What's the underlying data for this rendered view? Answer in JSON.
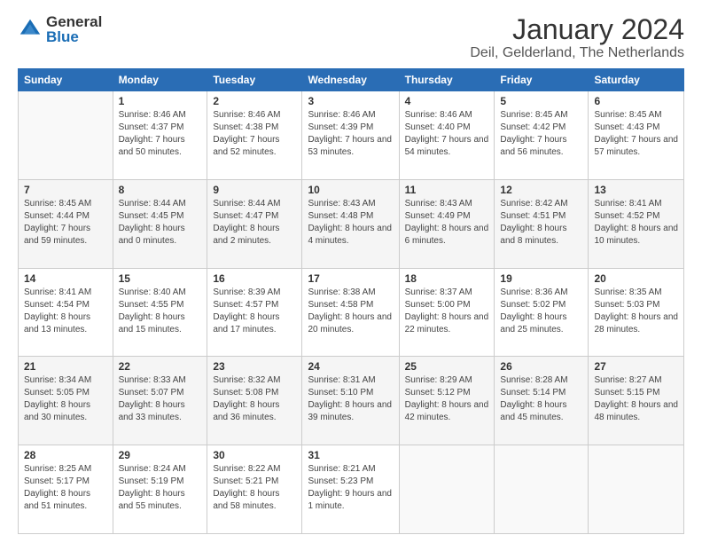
{
  "logo": {
    "general": "General",
    "blue": "Blue"
  },
  "header": {
    "month": "January 2024",
    "location": "Deil, Gelderland, The Netherlands"
  },
  "weekdays": [
    "Sunday",
    "Monday",
    "Tuesday",
    "Wednesday",
    "Thursday",
    "Friday",
    "Saturday"
  ],
  "weeks": [
    [
      {
        "day": "",
        "sunrise": "",
        "sunset": "",
        "daylight": ""
      },
      {
        "day": "1",
        "sunrise": "Sunrise: 8:46 AM",
        "sunset": "Sunset: 4:37 PM",
        "daylight": "Daylight: 7 hours and 50 minutes."
      },
      {
        "day": "2",
        "sunrise": "Sunrise: 8:46 AM",
        "sunset": "Sunset: 4:38 PM",
        "daylight": "Daylight: 7 hours and 52 minutes."
      },
      {
        "day": "3",
        "sunrise": "Sunrise: 8:46 AM",
        "sunset": "Sunset: 4:39 PM",
        "daylight": "Daylight: 7 hours and 53 minutes."
      },
      {
        "day": "4",
        "sunrise": "Sunrise: 8:46 AM",
        "sunset": "Sunset: 4:40 PM",
        "daylight": "Daylight: 7 hours and 54 minutes."
      },
      {
        "day": "5",
        "sunrise": "Sunrise: 8:45 AM",
        "sunset": "Sunset: 4:42 PM",
        "daylight": "Daylight: 7 hours and 56 minutes."
      },
      {
        "day": "6",
        "sunrise": "Sunrise: 8:45 AM",
        "sunset": "Sunset: 4:43 PM",
        "daylight": "Daylight: 7 hours and 57 minutes."
      }
    ],
    [
      {
        "day": "7",
        "sunrise": "Sunrise: 8:45 AM",
        "sunset": "Sunset: 4:44 PM",
        "daylight": "Daylight: 7 hours and 59 minutes."
      },
      {
        "day": "8",
        "sunrise": "Sunrise: 8:44 AM",
        "sunset": "Sunset: 4:45 PM",
        "daylight": "Daylight: 8 hours and 0 minutes."
      },
      {
        "day": "9",
        "sunrise": "Sunrise: 8:44 AM",
        "sunset": "Sunset: 4:47 PM",
        "daylight": "Daylight: 8 hours and 2 minutes."
      },
      {
        "day": "10",
        "sunrise": "Sunrise: 8:43 AM",
        "sunset": "Sunset: 4:48 PM",
        "daylight": "Daylight: 8 hours and 4 minutes."
      },
      {
        "day": "11",
        "sunrise": "Sunrise: 8:43 AM",
        "sunset": "Sunset: 4:49 PM",
        "daylight": "Daylight: 8 hours and 6 minutes."
      },
      {
        "day": "12",
        "sunrise": "Sunrise: 8:42 AM",
        "sunset": "Sunset: 4:51 PM",
        "daylight": "Daylight: 8 hours and 8 minutes."
      },
      {
        "day": "13",
        "sunrise": "Sunrise: 8:41 AM",
        "sunset": "Sunset: 4:52 PM",
        "daylight": "Daylight: 8 hours and 10 minutes."
      }
    ],
    [
      {
        "day": "14",
        "sunrise": "Sunrise: 8:41 AM",
        "sunset": "Sunset: 4:54 PM",
        "daylight": "Daylight: 8 hours and 13 minutes."
      },
      {
        "day": "15",
        "sunrise": "Sunrise: 8:40 AM",
        "sunset": "Sunset: 4:55 PM",
        "daylight": "Daylight: 8 hours and 15 minutes."
      },
      {
        "day": "16",
        "sunrise": "Sunrise: 8:39 AM",
        "sunset": "Sunset: 4:57 PM",
        "daylight": "Daylight: 8 hours and 17 minutes."
      },
      {
        "day": "17",
        "sunrise": "Sunrise: 8:38 AM",
        "sunset": "Sunset: 4:58 PM",
        "daylight": "Daylight: 8 hours and 20 minutes."
      },
      {
        "day": "18",
        "sunrise": "Sunrise: 8:37 AM",
        "sunset": "Sunset: 5:00 PM",
        "daylight": "Daylight: 8 hours and 22 minutes."
      },
      {
        "day": "19",
        "sunrise": "Sunrise: 8:36 AM",
        "sunset": "Sunset: 5:02 PM",
        "daylight": "Daylight: 8 hours and 25 minutes."
      },
      {
        "day": "20",
        "sunrise": "Sunrise: 8:35 AM",
        "sunset": "Sunset: 5:03 PM",
        "daylight": "Daylight: 8 hours and 28 minutes."
      }
    ],
    [
      {
        "day": "21",
        "sunrise": "Sunrise: 8:34 AM",
        "sunset": "Sunset: 5:05 PM",
        "daylight": "Daylight: 8 hours and 30 minutes."
      },
      {
        "day": "22",
        "sunrise": "Sunrise: 8:33 AM",
        "sunset": "Sunset: 5:07 PM",
        "daylight": "Daylight: 8 hours and 33 minutes."
      },
      {
        "day": "23",
        "sunrise": "Sunrise: 8:32 AM",
        "sunset": "Sunset: 5:08 PM",
        "daylight": "Daylight: 8 hours and 36 minutes."
      },
      {
        "day": "24",
        "sunrise": "Sunrise: 8:31 AM",
        "sunset": "Sunset: 5:10 PM",
        "daylight": "Daylight: 8 hours and 39 minutes."
      },
      {
        "day": "25",
        "sunrise": "Sunrise: 8:29 AM",
        "sunset": "Sunset: 5:12 PM",
        "daylight": "Daylight: 8 hours and 42 minutes."
      },
      {
        "day": "26",
        "sunrise": "Sunrise: 8:28 AM",
        "sunset": "Sunset: 5:14 PM",
        "daylight": "Daylight: 8 hours and 45 minutes."
      },
      {
        "day": "27",
        "sunrise": "Sunrise: 8:27 AM",
        "sunset": "Sunset: 5:15 PM",
        "daylight": "Daylight: 8 hours and 48 minutes."
      }
    ],
    [
      {
        "day": "28",
        "sunrise": "Sunrise: 8:25 AM",
        "sunset": "Sunset: 5:17 PM",
        "daylight": "Daylight: 8 hours and 51 minutes."
      },
      {
        "day": "29",
        "sunrise": "Sunrise: 8:24 AM",
        "sunset": "Sunset: 5:19 PM",
        "daylight": "Daylight: 8 hours and 55 minutes."
      },
      {
        "day": "30",
        "sunrise": "Sunrise: 8:22 AM",
        "sunset": "Sunset: 5:21 PM",
        "daylight": "Daylight: 8 hours and 58 minutes."
      },
      {
        "day": "31",
        "sunrise": "Sunrise: 8:21 AM",
        "sunset": "Sunset: 5:23 PM",
        "daylight": "Daylight: 9 hours and 1 minute."
      },
      {
        "day": "",
        "sunrise": "",
        "sunset": "",
        "daylight": ""
      },
      {
        "day": "",
        "sunrise": "",
        "sunset": "",
        "daylight": ""
      },
      {
        "day": "",
        "sunrise": "",
        "sunset": "",
        "daylight": ""
      }
    ]
  ]
}
